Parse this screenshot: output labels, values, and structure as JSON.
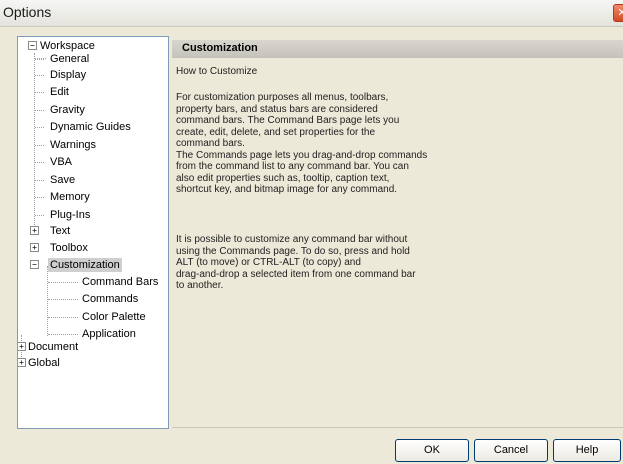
{
  "window": {
    "title": "Options",
    "close_glyph": "✕"
  },
  "tree": {
    "items": [
      {
        "label": "Workspace",
        "expander": "−"
      },
      {
        "label": "General"
      },
      {
        "label": "Display"
      },
      {
        "label": "Edit"
      },
      {
        "label": "Gravity"
      },
      {
        "label": "Dynamic Guides"
      },
      {
        "label": "Warnings"
      },
      {
        "label": "VBA"
      },
      {
        "label": "Save"
      },
      {
        "label": "Memory"
      },
      {
        "label": "Plug-Ins"
      },
      {
        "label": "Text",
        "expander": "+"
      },
      {
        "label": "Toolbox",
        "expander": "+"
      },
      {
        "label": "Customization",
        "expander": "−",
        "selected": true
      },
      {
        "label": "Command Bars"
      },
      {
        "label": "Commands"
      },
      {
        "label": "Color Palette"
      },
      {
        "label": "Application"
      },
      {
        "label": "Document",
        "expander": "+"
      },
      {
        "label": "Global",
        "expander": "+"
      }
    ]
  },
  "content": {
    "header": "Customization",
    "intro": "How to Customize",
    "paragraph1": "For customization purposes all menus, toolbars,\nproperty bars, and status bars are considered\ncommand bars. The Command Bars page lets you\ncreate, edit, delete, and set properties for the\ncommand bars.\nThe Commands page lets you drag-and-drop commands\nfrom the command list to any command bar. You can\nalso edit properties such as, tooltip, caption text,\nshortcut key, and bitmap image for any command.",
    "paragraph2": "It is possible to customize any command bar without\nusing the Commands page. To do so, press and hold\nALT (to move) or CTRL-ALT (to copy) and\ndrag-and-drop a selected item from one command bar\nto another."
  },
  "buttons": {
    "ok": "OK",
    "cancel": "Cancel",
    "help": "Help"
  }
}
